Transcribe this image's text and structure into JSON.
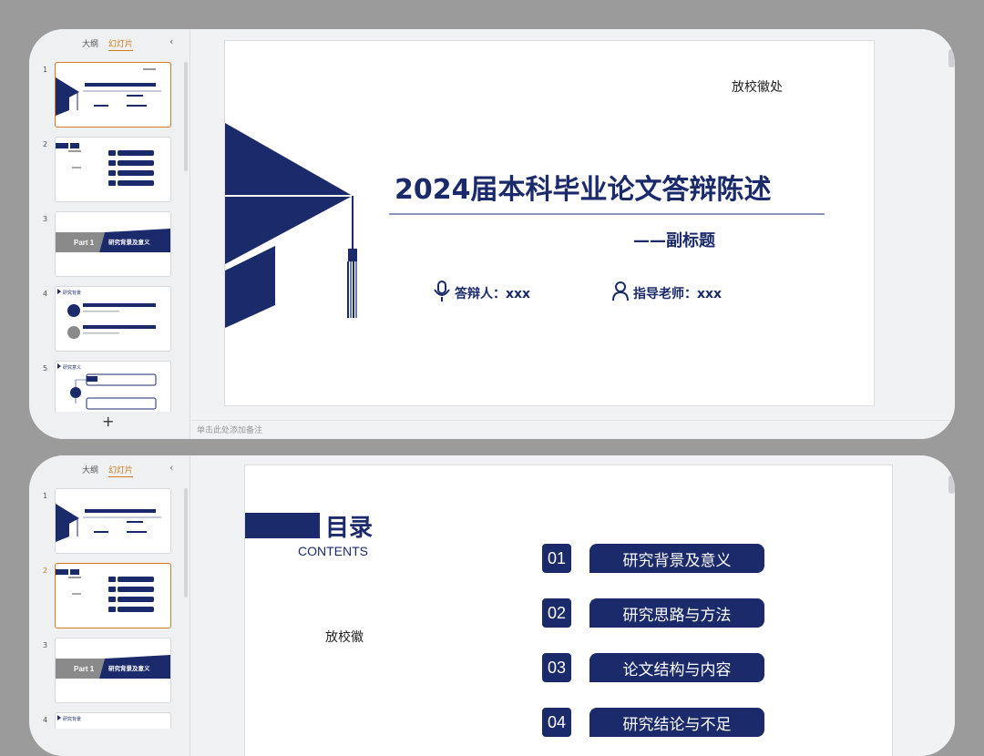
{
  "panel": {
    "tab_outline": "大纲",
    "tab_slides": "幻灯片",
    "collapse": "‹",
    "add": "+"
  },
  "notes_placeholder": "单击此处添加备注",
  "slide1": {
    "logo": "放校徽处",
    "title": "2024届本科毕业论文答辩陈述",
    "subtitle": "——副标题",
    "defender": "答辩人：xxx",
    "advisor": "指导老师：xxx"
  },
  "slide2": {
    "title": "目录",
    "title_en": "CONTENTS",
    "logo": "放校徽",
    "items": [
      {
        "num": "01",
        "label": "研究背景及意义"
      },
      {
        "num": "02",
        "label": "研究思路与方法"
      },
      {
        "num": "03",
        "label": "论文结构与内容"
      },
      {
        "num": "04",
        "label": "研究结论与不足"
      }
    ]
  },
  "thumbs": {
    "t3_part": "Part 1",
    "t3_title": "研究背景及意义",
    "t4_title": "研究背景",
    "t5_title": "研究意义"
  },
  "win1_slide_numbers": [
    "1",
    "2",
    "3",
    "4",
    "5"
  ],
  "win2_slide_numbers": [
    "1",
    "2",
    "3",
    "4"
  ],
  "colors": {
    "navy": "#1b2a6b",
    "accent": "#d27a1e",
    "gray": "#8a8a8a"
  }
}
